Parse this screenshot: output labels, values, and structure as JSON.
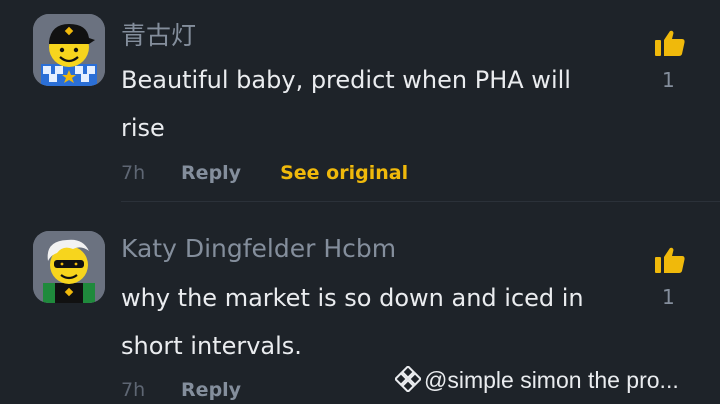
{
  "comments": [
    {
      "username": "青古灯",
      "text": "Beautiful baby, predict when PHA will rise",
      "time": "7h",
      "reply_label": "Reply",
      "see_original_label": "See original",
      "likes": "1"
    },
    {
      "username": "Katy Dingfelder Hcbm",
      "text": "why the market is so down and iced in short intervals.",
      "time": "7h",
      "reply_label": "Reply",
      "likes": "1"
    }
  ],
  "watermark": "@simple simon the pro...",
  "colors": {
    "background": "#1e2329",
    "accent": "#f0b90b",
    "primary_text": "#eaecef",
    "secondary_text": "#848e9c",
    "like_icon": "#f0b90b"
  }
}
